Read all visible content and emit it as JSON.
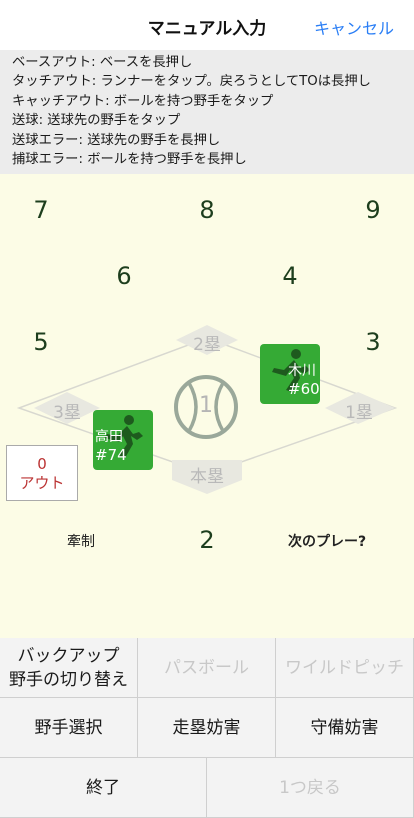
{
  "header": {
    "title": "マニュアル入力",
    "cancel_label": "キャンセル"
  },
  "instructions": [
    "ベースアウト: ベースを長押し",
    "タッチアウト: ランナーをタップ。戻ろうとしてTOは長押し",
    "キャッチアウト: ボールを持つ野手をタップ",
    "送球: 送球先の野手をタップ",
    "送球エラー: 送球先の野手を長押し",
    "捕球エラー: ボールを持つ野手を長押し"
  ],
  "field": {
    "positions": {
      "p7": "7",
      "p8": "8",
      "p9": "9",
      "p6": "6",
      "p4": "4",
      "p5": "5",
      "p3": "3",
      "p1": "1",
      "p2": "2"
    },
    "bases": {
      "second": "2塁",
      "third": "3塁",
      "first": "1塁",
      "home": "本塁"
    },
    "runners": [
      {
        "name": "木川",
        "number": "#60"
      },
      {
        "name": "高田",
        "number": "#74"
      }
    ],
    "outs": {
      "count": "0",
      "label": "アウト"
    },
    "restrain_label": "牽制",
    "next_play_label": "次のプレー?"
  },
  "buttons": {
    "backup": [
      "バックアップ",
      "野手の切り替え"
    ],
    "passed_ball": "パスボール",
    "wild_pitch": "ワイルドピッチ",
    "fielder_select": "野手選択",
    "obstruction_runner": "走塁妨害",
    "obstruction_defense": "守備妨害",
    "finish": "終了",
    "undo": "1つ戻る"
  },
  "colors": {
    "accent": "#2a7ef5",
    "field_bg": "#fcfce6",
    "runner_bg": "#35aa35",
    "outs_text": "#b33333",
    "position_text": "#1d3e1d"
  }
}
